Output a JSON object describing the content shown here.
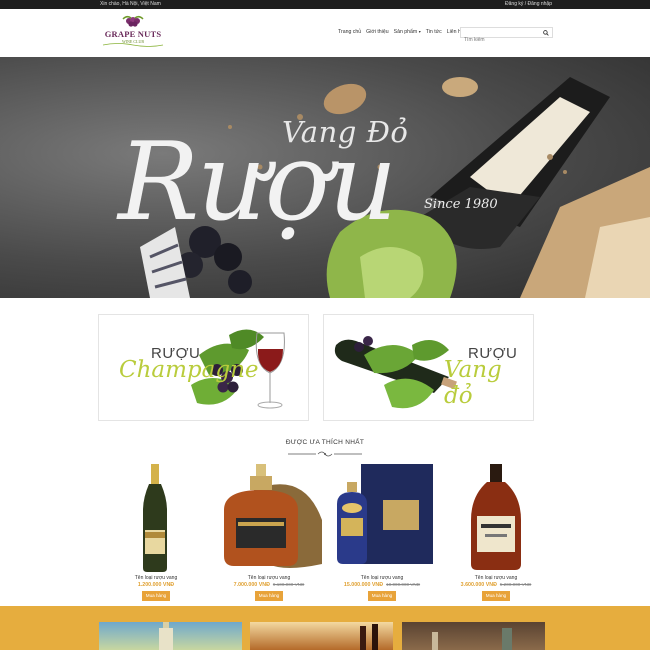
{
  "topbar": {
    "greeting": "Xin chào, Hà Nội, Việt Nam",
    "auth": "Đăng ký / Đăng nhập"
  },
  "logo": {
    "brand": "GRAPE NUTS",
    "subtitle": "WINE CLUB"
  },
  "nav": {
    "items": [
      "Trang chủ",
      "Giới thiệu",
      "Sản phẩm",
      "Tin tức",
      "Liên hệ"
    ]
  },
  "search": {
    "placeholder": "Tìm kiếm"
  },
  "hero": {
    "line1": "Vang Đỏ",
    "line2": "Rượu",
    "since": "Since 1980"
  },
  "banners": [
    {
      "small": "RƯỢU",
      "script": "Champagne"
    },
    {
      "small": "RƯỢU",
      "script": "Vang đỏ"
    }
  ],
  "section": {
    "title": "ĐƯỢC ƯA THÍCH NHẤT"
  },
  "products": [
    {
      "name": "Tên loại rượu vang",
      "price": "1.200.000 VNĐ",
      "old_price": "",
      "buy": "Mua hàng"
    },
    {
      "name": "Tên loại rượu vang",
      "price": "7.000.000 VNĐ",
      "old_price": "9.100.000 VNĐ",
      "buy": "Mua hàng"
    },
    {
      "name": "Tên loại rượu vang",
      "price": "15.000.000 VNĐ",
      "old_price": "18.000.000 VNĐ",
      "buy": "Mua hàng"
    },
    {
      "name": "Tên loại rượu vang",
      "price": "3.600.000 VNĐ",
      "old_price": "5.200.000 VNĐ",
      "buy": "Mua hàng"
    }
  ],
  "colors": {
    "accent": "#e8a33a",
    "topbar": "#1e1e1e",
    "band": "#e6ad3e",
    "script_green": "#b9cc3c"
  }
}
